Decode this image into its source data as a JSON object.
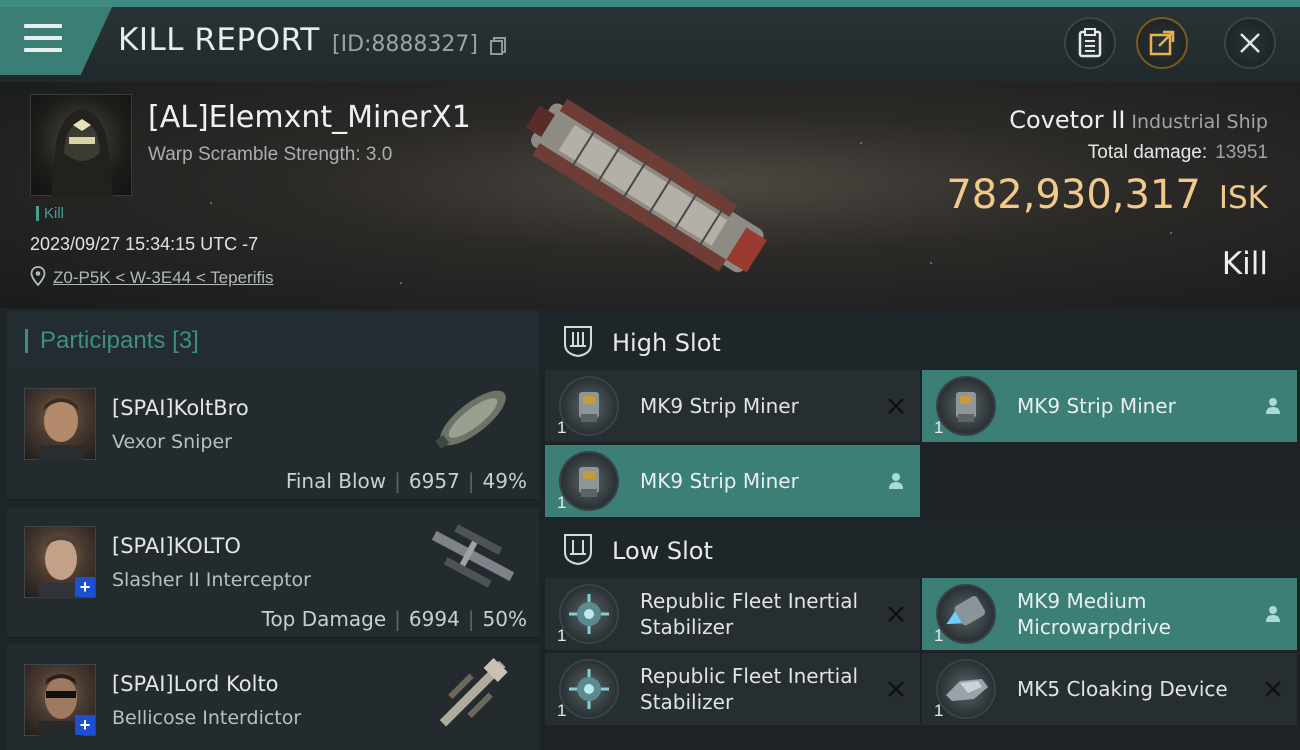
{
  "header": {
    "title": "KILL REPORT",
    "report_id": "[ID:8888327]"
  },
  "victim": {
    "name": "[AL]Elemxnt_MinerX1",
    "warp_scramble": "Warp Scramble Strength: 3.0",
    "kill_tag": "Kill",
    "datetime": "2023/09/27 15:34:15 UTC -7",
    "location": "Z0-P5K < W-3E44 < Teperifis",
    "ship_name": "Covetor II",
    "ship_type": "Industrial Ship",
    "damage_label": "Total damage:",
    "damage_value": "13951",
    "isk_value": "782,930,317",
    "isk_unit": "ISK",
    "result": "Kill"
  },
  "participants": {
    "title": "Participants",
    "count": "[3]",
    "list": [
      {
        "name": "[SPAI]KoltBro",
        "ship": "Vexor Sniper",
        "role": "Final Blow",
        "damage": "6957",
        "percent": "49%",
        "portrait_color": "#8a6a52",
        "plus": false
      },
      {
        "name": "[SPAI]KOLTO",
        "ship": "Slasher II Interceptor",
        "role": "Top Damage",
        "damage": "6994",
        "percent": "50%",
        "portrait_color": "#7a6858",
        "plus": true
      },
      {
        "name": "[SPAI]Lord Kolto",
        "ship": "Bellicose Interdictor",
        "role": "",
        "damage": "",
        "percent": "",
        "portrait_color": "#6b4e3e",
        "plus": true
      }
    ]
  },
  "slots": {
    "high": {
      "title": "High Slot",
      "items": [
        {
          "name": "MK9 Strip Miner",
          "qty": "1",
          "status": "destroyed",
          "icon": "strip-miner-icon"
        },
        {
          "name": "MK9 Strip Miner",
          "qty": "1",
          "status": "dropped",
          "icon": "strip-miner-icon"
        },
        {
          "name": "MK9 Strip Miner",
          "qty": "1",
          "status": "dropped",
          "icon": "strip-miner-icon"
        }
      ]
    },
    "low": {
      "title": "Low Slot",
      "items": [
        {
          "name": "Republic Fleet Inertial Stabilizer",
          "qty": "1",
          "status": "destroyed",
          "icon": "inertial-stabilizer-icon"
        },
        {
          "name": "MK9 Medium Microwarpdrive",
          "qty": "1",
          "status": "dropped",
          "icon": "microwarpdrive-icon"
        },
        {
          "name": "Republic Fleet Inertial Stabilizer",
          "qty": "1",
          "status": "destroyed",
          "icon": "inertial-stabilizer-icon"
        },
        {
          "name": "MK5 Cloaking Device",
          "qty": "1",
          "status": "destroyed",
          "icon": "cloaking-device-icon"
        }
      ]
    }
  },
  "colors": {
    "accent": "#3b7f77",
    "isk": "#f0c98b",
    "plus_badge": "#1e4fd0"
  }
}
